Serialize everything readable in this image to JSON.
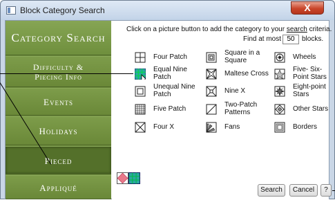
{
  "window": {
    "title": "Block Category Search",
    "close_label": "X"
  },
  "sidebar": {
    "header": "Category Search",
    "items": [
      {
        "label_line1": "Difficulty &",
        "label_line2": "Piecing Info"
      },
      {
        "label": "Events"
      },
      {
        "label": "Holidays"
      },
      {
        "label": "Pieced"
      },
      {
        "label": "Appliqué"
      }
    ]
  },
  "instruction": {
    "before": "Click on a picture button to add the category to your ",
    "link": "search",
    "after": " criteria."
  },
  "find": {
    "prefix": "Find at most",
    "value": "50",
    "suffix": "blocks."
  },
  "categories": {
    "col1": [
      {
        "line1": "Four Patch",
        "line2": ""
      },
      {
        "line1": "Equal Nine",
        "line2": "Patch"
      },
      {
        "line1": "Unequal Nine",
        "line2": "Patch"
      },
      {
        "line1": "Five Patch",
        "line2": ""
      },
      {
        "line1": "Four X",
        "line2": ""
      }
    ],
    "col2": [
      {
        "line1": "Square in a",
        "line2": "Square"
      },
      {
        "line1": "Maltese Cross",
        "line2": ""
      },
      {
        "line1": "Nine X",
        "line2": ""
      },
      {
        "line1": "Two-Patch",
        "line2": "Patterns"
      },
      {
        "line1": "Fans",
        "line2": ""
      }
    ],
    "col3": [
      {
        "line1": "Wheels",
        "line2": ""
      },
      {
        "line1": "Five- Six-",
        "line2": "Point Stars"
      },
      {
        "line1": "Eight-point",
        "line2": "Stars"
      },
      {
        "line1": "Other Stars",
        "line2": ""
      },
      {
        "line1": "Borders",
        "line2": ""
      }
    ]
  },
  "buttons": {
    "search": "Search",
    "cancel": "Cancel",
    "help": "?"
  },
  "colors": {
    "sidebar": "#6e8d3d",
    "selected_item": "#54702a",
    "accent_teal": "#2aa7a0"
  }
}
